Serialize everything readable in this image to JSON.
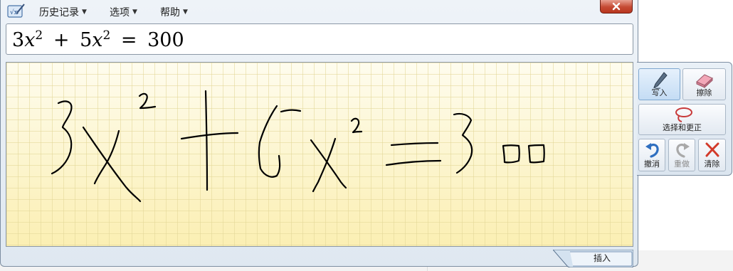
{
  "menu": {
    "history_label": "历史记录",
    "options_label": "选项",
    "help_label": "帮助"
  },
  "formula": {
    "base1": "3",
    "var1": "x",
    "exp1": "2",
    "op1": "+",
    "base2": "5",
    "var2": "x",
    "exp2": "2",
    "op2": "=",
    "rhs": "300"
  },
  "tools": {
    "write_label": "写入",
    "erase_label": "擦除",
    "select_correct_label": "选择和更正",
    "undo_label": "撤消",
    "redo_label": "重做",
    "clear_label": "清除"
  },
  "insert_label": "插入",
  "colors": {
    "pad_background": "#fdf7cf",
    "grid_line": "#e2d696",
    "ink": "#000000",
    "close_red": "#c54a33",
    "undo_blue": "#2f6fc0",
    "clear_red": "#d23a2a"
  }
}
